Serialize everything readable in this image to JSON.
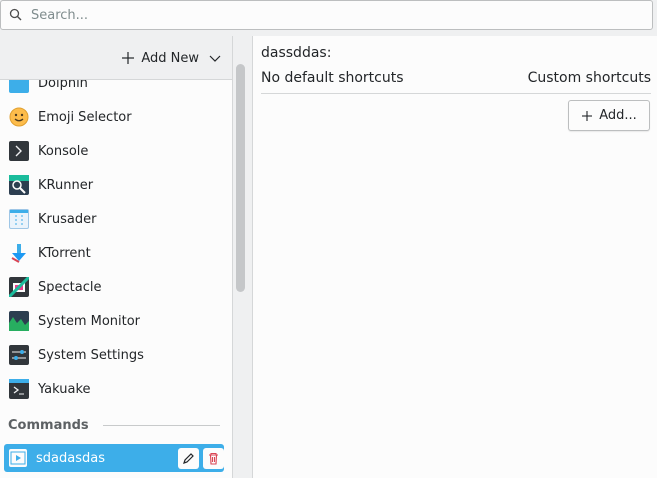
{
  "search": {
    "placeholder": "Search..."
  },
  "left": {
    "add_new_label": "Add New",
    "apps": [
      {
        "label": "Dolphin",
        "icon": "dolphin-icon"
      },
      {
        "label": "Emoji Selector",
        "icon": "emoji-icon"
      },
      {
        "label": "Konsole",
        "icon": "konsole-icon"
      },
      {
        "label": "KRunner",
        "icon": "krunner-icon"
      },
      {
        "label": "Krusader",
        "icon": "krusader-icon"
      },
      {
        "label": "KTorrent",
        "icon": "ktorrent-icon"
      },
      {
        "label": "Spectacle",
        "icon": "spectacle-icon"
      },
      {
        "label": "System Monitor",
        "icon": "system-monitor-icon"
      },
      {
        "label": "System Settings",
        "icon": "system-settings-icon"
      },
      {
        "label": "Yakuake",
        "icon": "yakuake-icon"
      }
    ],
    "commands_section": "Commands",
    "selected_command": "sdadasdas"
  },
  "right": {
    "title": "dassddas:",
    "col_default": "No default shortcuts",
    "col_custom": "Custom shortcuts",
    "add_button": "Add..."
  },
  "colors": {
    "accent": "#3daee9",
    "window_bg": "#eff0f1",
    "view_bg": "#fcfcfc",
    "delete_red": "#da4453"
  }
}
